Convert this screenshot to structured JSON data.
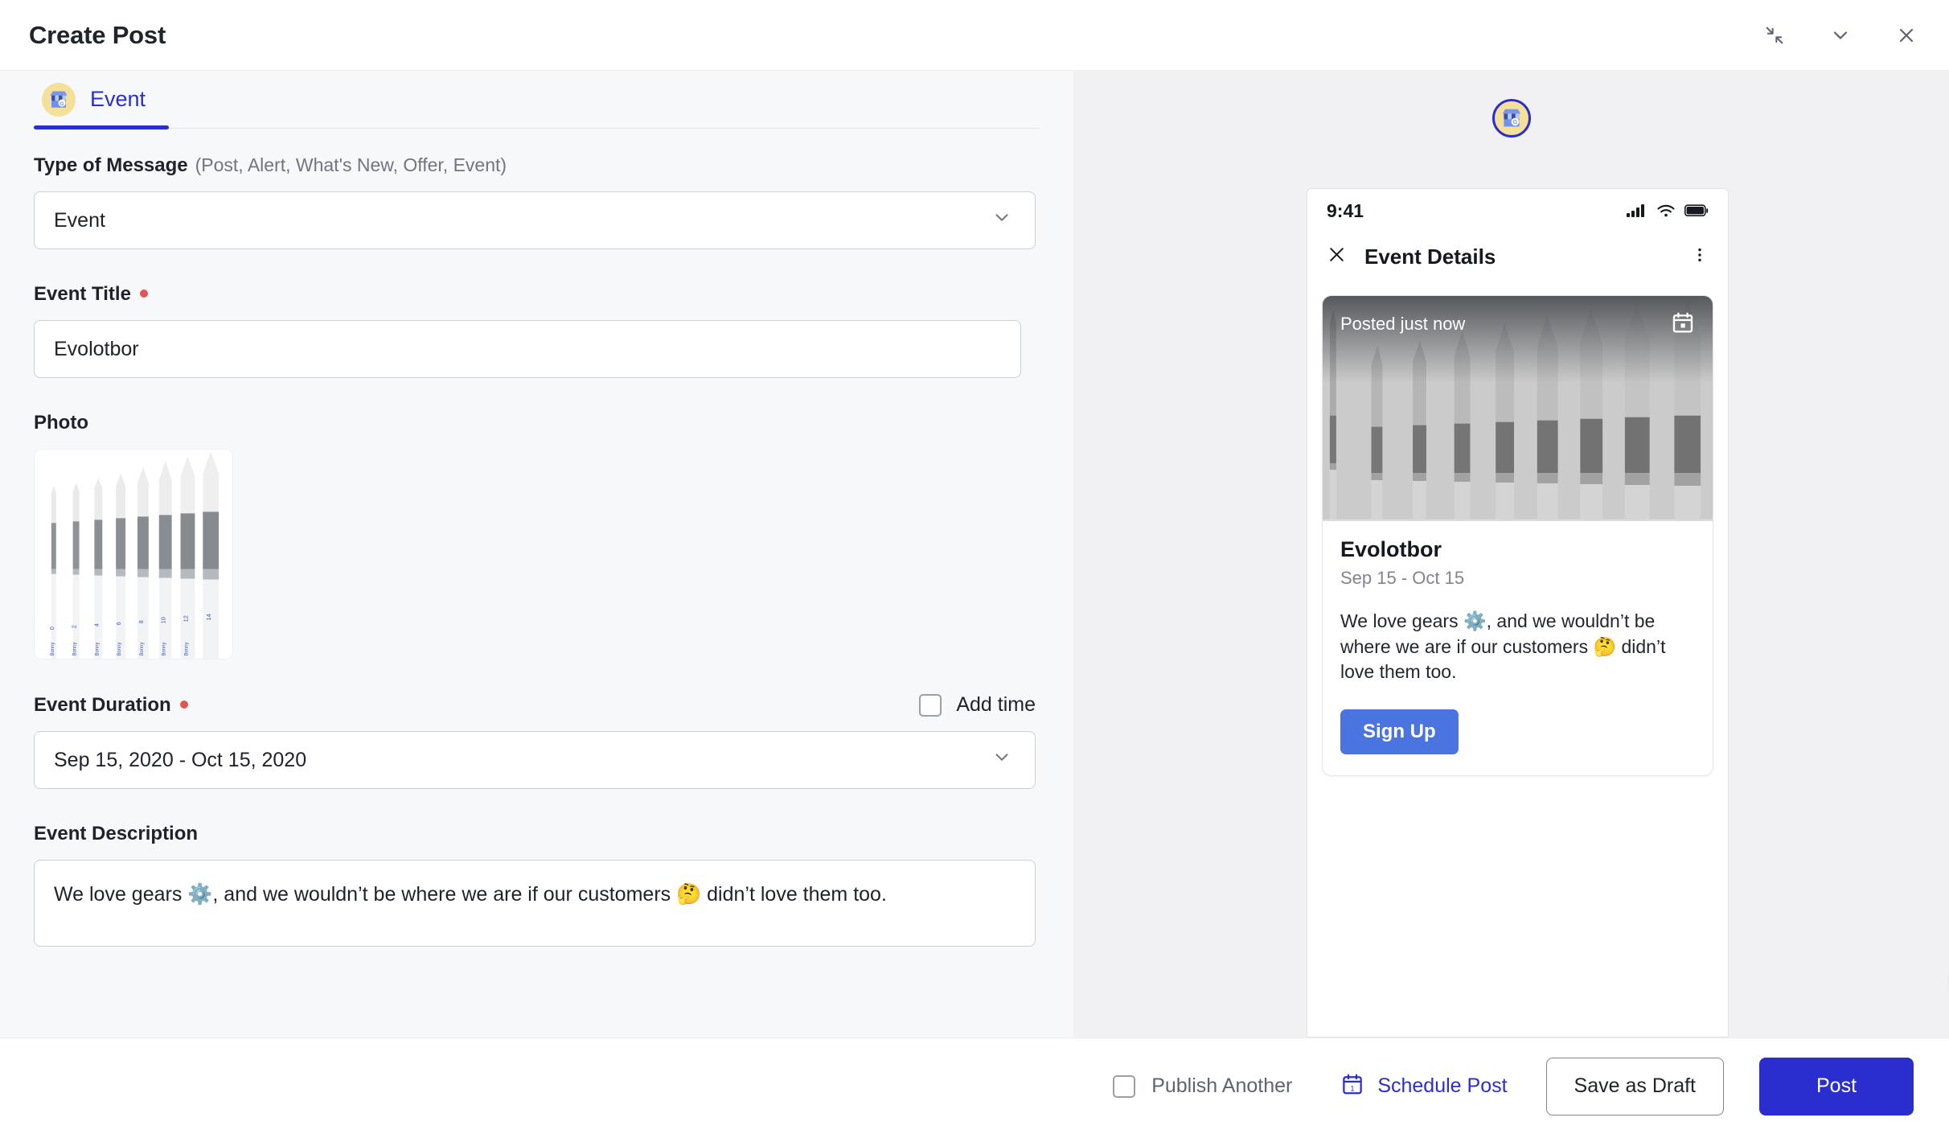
{
  "window": {
    "title": "Create Post",
    "controls": [
      {
        "name": "collapse-icon",
        "label": "Collapse"
      },
      {
        "name": "chevron-down-icon",
        "label": "Minimize"
      },
      {
        "name": "close-icon",
        "label": "Close"
      }
    ]
  },
  "tabs": [
    {
      "id": "event",
      "label": "Event",
      "icon": "google-business-profile-icon",
      "active": true
    }
  ],
  "form": {
    "type_of_message": {
      "label": "Type of Message",
      "hint": "(Post, Alert, What's New, Offer, Event)",
      "value": "Event",
      "required": false
    },
    "event_title": {
      "label": "Event Title",
      "value": "Evolotbor",
      "required": true
    },
    "photo": {
      "label": "Photo",
      "alt": "Set of white-handled round paint brushes sized 0 through 14"
    },
    "event_duration": {
      "label": "Event Duration",
      "value": "Sep 15, 2020 - Oct 15, 2020",
      "required": true,
      "add_time_label": "Add time",
      "add_time_checked": false
    },
    "event_description": {
      "label": "Event Description",
      "value": "We love gears ⚙️, and we wouldn’t be where we are if our customers 🤔 didn’t love them too."
    }
  },
  "preview": {
    "channel_icon": "google-business-profile-icon",
    "phone": {
      "status_time": "9:41",
      "screen_title": "Event Details",
      "post": {
        "posted_label": "Posted just now",
        "title": "Evolotbor",
        "dates": "Sep 15 - Oct 15",
        "description": "We love gears ⚙️, and we wouldn’t be where we are if our customers 🤔 didn’t love them too.",
        "cta_label": "Sign Up"
      }
    },
    "device_toggle": [
      {
        "id": "mobile",
        "icon": "mobile-icon",
        "active": true
      },
      {
        "id": "desktop",
        "icon": "desktop-icon",
        "active": false
      }
    ]
  },
  "footer": {
    "publish_another_label": "Publish Another",
    "publish_another_checked": false,
    "schedule_post_label": "Schedule Post",
    "save_draft_label": "Save as Draft",
    "post_label": "Post"
  },
  "colors": {
    "brand_blue": "#2b2ecf",
    "cta_blue": "#4a75e0",
    "required_red": "#e0564f",
    "panel_bg": "#f7f8fa",
    "preview_bg": "#f1f1f3"
  }
}
